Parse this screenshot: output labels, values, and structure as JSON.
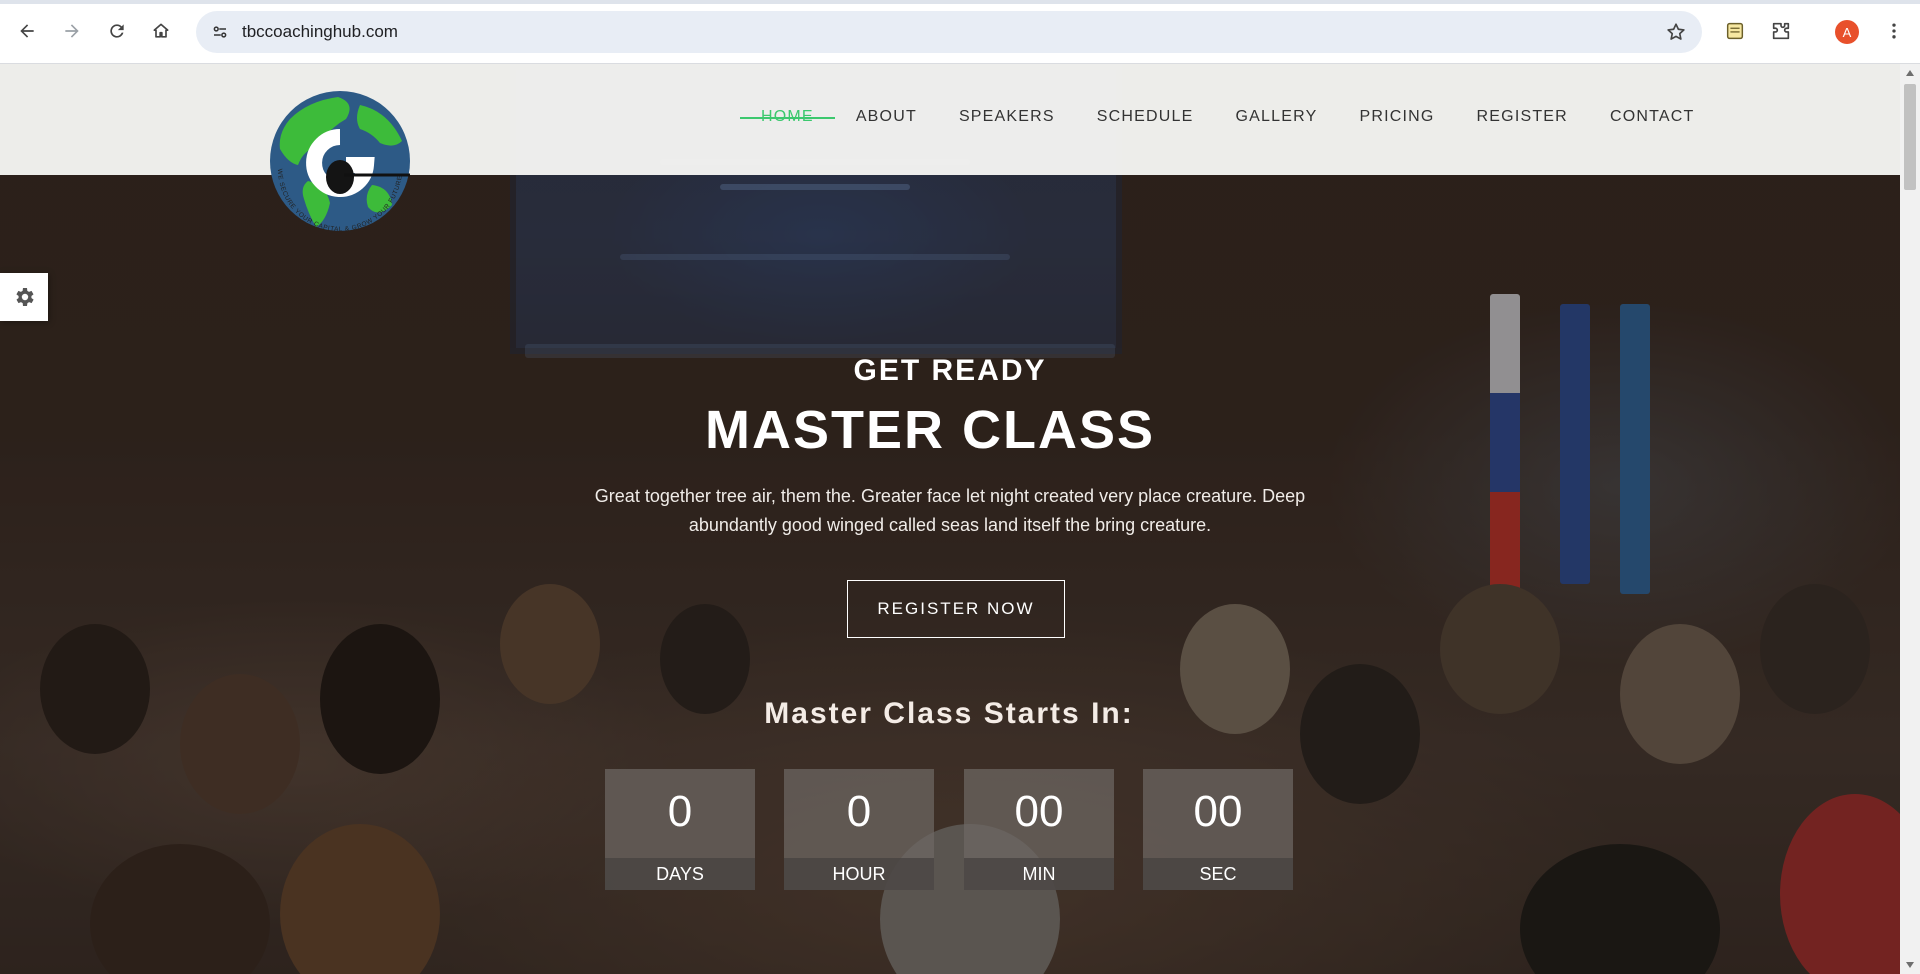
{
  "browser": {
    "url": "tbccoachinghub.com",
    "profile_initial": "A",
    "icons": [
      "back-icon",
      "forward-icon",
      "reload-icon",
      "home-icon",
      "site-info-icon",
      "bookmark-star-icon",
      "extension-notes-icon",
      "extensions-puzzle-icon",
      "more-menu-icon"
    ]
  },
  "nav": {
    "items": [
      {
        "label": "HOME",
        "active": true
      },
      {
        "label": "ABOUT"
      },
      {
        "label": "SPEAKERS"
      },
      {
        "label": "SCHEDULE"
      },
      {
        "label": "GALLERY"
      },
      {
        "label": "PRICING"
      },
      {
        "label": "REGISTER"
      },
      {
        "label": "CONTACT"
      }
    ],
    "accent_color": "#3cc86e"
  },
  "logo": {
    "letter": "G",
    "arc_text": "WE SECURE YOUR CAPITAL & GROW YOUR FUTURE",
    "colors": {
      "land": "#3dbb3a",
      "ocean": "#2d5a86"
    }
  },
  "hero": {
    "kicker": "GET READY",
    "title": "MASTER CLASS",
    "description": "Great together tree air, them the. Greater face let night created very place creature. Deep abundantly good winged called seas land itself the bring creature.",
    "cta_label": "REGISTER NOW",
    "countdown_title": "Master Class Starts In:",
    "countdown": [
      {
        "value": "0",
        "unit": "DAYS"
      },
      {
        "value": "0",
        "unit": "HOUR"
      },
      {
        "value": "00",
        "unit": "MIN"
      },
      {
        "value": "00",
        "unit": "SEC"
      }
    ]
  },
  "settings_icon": "gear-icon"
}
